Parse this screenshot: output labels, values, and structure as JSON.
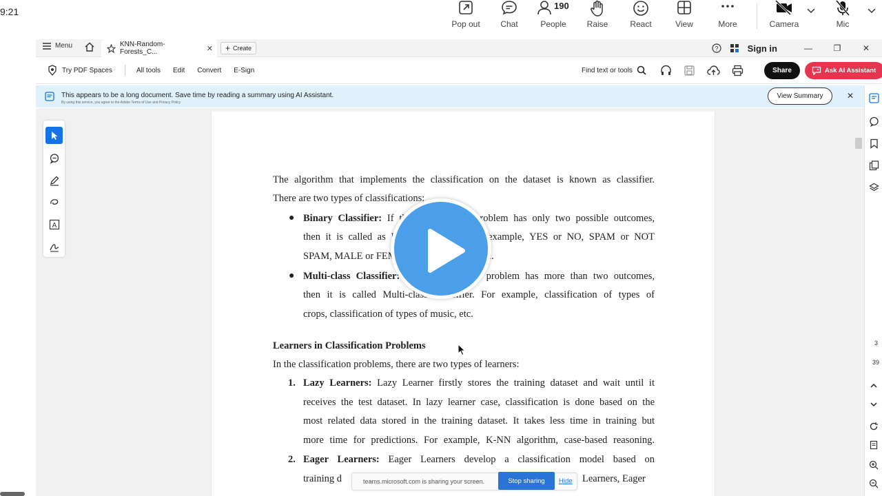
{
  "teams": {
    "time": "9:21",
    "items": [
      {
        "label": "Pop out",
        "icon": "pop-out-icon"
      },
      {
        "label": "Chat",
        "icon": "chat-icon"
      },
      {
        "label": "People",
        "icon": "people-icon",
        "count": "190"
      },
      {
        "label": "Raise",
        "icon": "raise-hand-icon"
      },
      {
        "label": "React",
        "icon": "react-smiley-icon"
      },
      {
        "label": "View",
        "icon": "view-grid-icon"
      },
      {
        "label": "More",
        "icon": "more-dots-icon"
      },
      {
        "label": "Camera",
        "icon": "camera-off-icon"
      },
      {
        "label": "Mic",
        "icon": "mic-off-icon"
      }
    ]
  },
  "acrobat": {
    "menu_label": "Menu",
    "tab_title": "KNN-Random-Forests_C...",
    "create_label": "Create",
    "sign_in": "Sign in",
    "toolbar": {
      "try_pdf_spaces": "Try PDF Spaces",
      "all_tools": "All tools",
      "edit": "Edit",
      "convert": "Convert",
      "esign": "E-Sign",
      "find_placeholder": "Find text or tools",
      "share": "Share",
      "ask_ai": "Ask AI Assistant"
    },
    "banner": {
      "text": "This appears to be a long document. Save time by reading a summary using AI Assistant.",
      "subtext": "By using this service, you agree to the Adobe Terms of Use and Privacy Policy",
      "button": "View Summary"
    },
    "page_numbers": [
      "3",
      "39"
    ],
    "accent": "#1473e6"
  },
  "document": {
    "para1_line1": "The algorithm that implements the classification on the dataset is known as classifier.",
    "para1_line2": "There are two types of classifications:",
    "b1_term": "Binary Classifier:",
    "b1_line1_rest": " If the classification problem has only two possible outcomes,",
    "b1_line2": "then it is called as Binary Classifier. For example, YES or NO, SPAM or NOT",
    "b1_line3": "SPAM, MALE or FEMALE, CAT or DOG, etc.",
    "b2_term": "Multi-class Classifier:",
    "b2_line1_rest": " If a classification problem has more than two outcomes,",
    "b2_line2": "then it is called Multi-class Classifier.  For example, classification of types of",
    "b2_line3": "crops, classification of types of music, etc.",
    "heading": "Learners in Classification Problems",
    "intro": "In the classification problems, there are two types of learners:",
    "n1": "1.",
    "n1_term": "Lazy Learners:",
    "n1_line1_rest": " Lazy Learner firstly stores the training dataset and wait until it",
    "n1_line2": "receives the test dataset.  In lazy learner case, classification is done based on the",
    "n1_line3": "most related data stored in the training dataset.  It takes less time in training but",
    "n1_line4": "more time for predictions.  For example, K-NN algorithm, case-based reasoning.",
    "n2": "2.",
    "n2_term": "Eager Learners:",
    "n2_line1_rest": " Eager Learners develop a classification model based on",
    "n2_line2_start": "training d",
    "n2_line2_end": "Learners, Eager"
  },
  "share_notice": {
    "text": "teams.microsoft.com is sharing your screen.",
    "stop": "Stop sharing",
    "hide": "Hide"
  }
}
